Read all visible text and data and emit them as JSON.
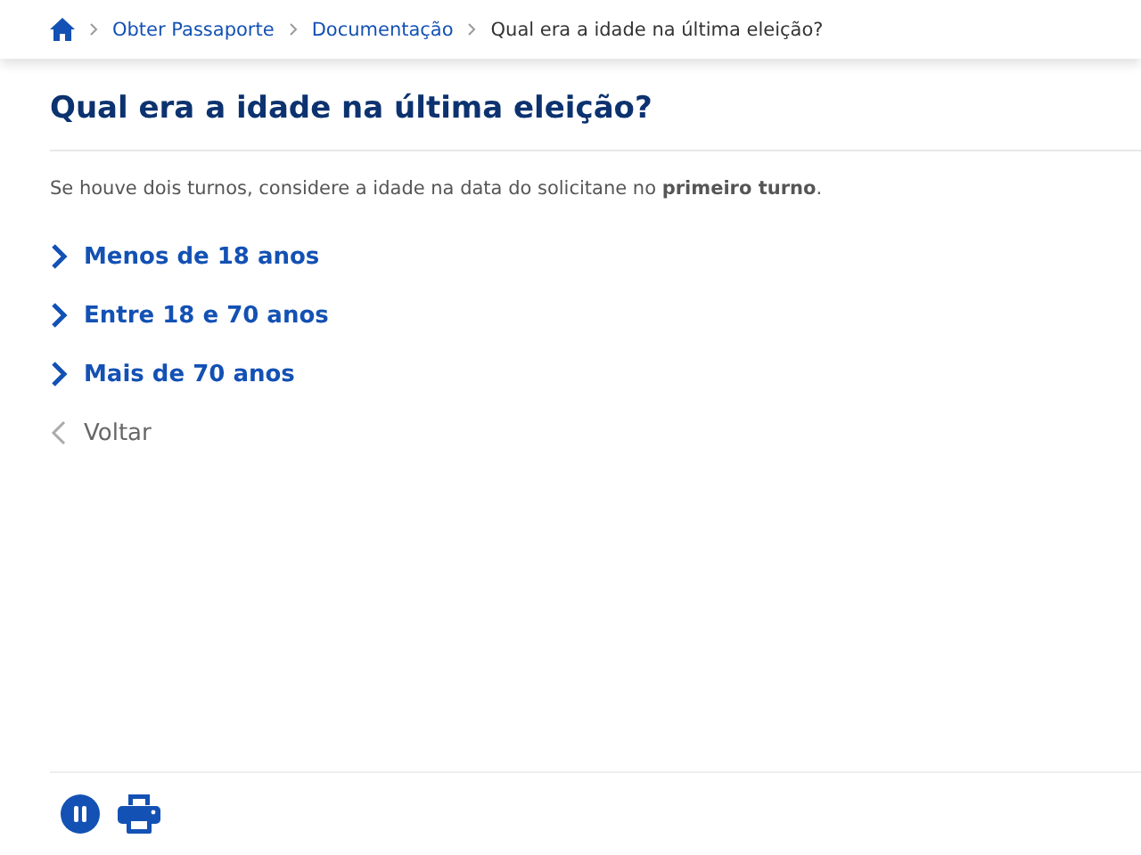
{
  "breadcrumb": [
    {
      "label": "Obter Passaporte",
      "current": false
    },
    {
      "label": "Documentação",
      "current": false
    },
    {
      "label": "Qual era a idade na última eleição?",
      "current": true
    }
  ],
  "title": "Qual era a idade na última eleição?",
  "hint": "Se houve dois turnos, considere a idade na data do solicitane no **primeiro turno**.",
  "options": [
    {
      "kind": "forward",
      "label": "Menos de 18 anos"
    },
    {
      "kind": "forward",
      "label": "Entre 18 e 70 anos"
    },
    {
      "kind": "forward",
      "label": "Mais de 70 anos"
    },
    {
      "kind": "back",
      "label": "Voltar"
    }
  ]
}
